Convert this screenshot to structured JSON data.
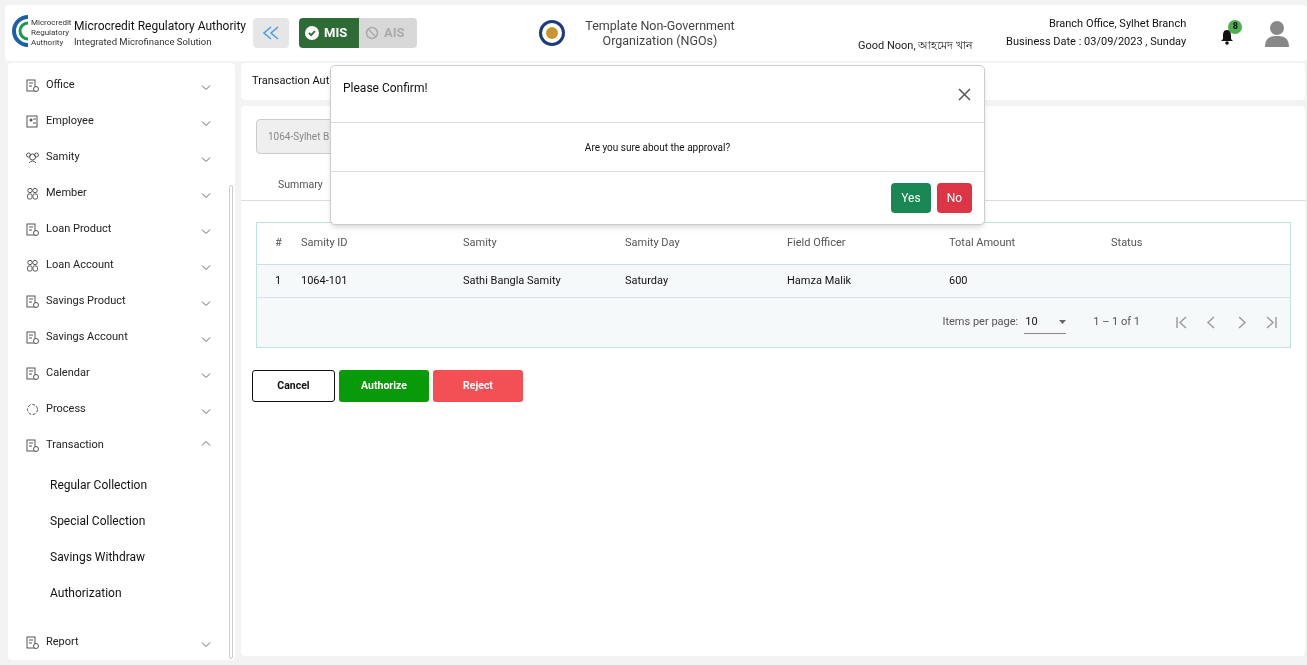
{
  "header": {
    "logo_text": [
      "Microcredit",
      "Regulatory",
      "Authority"
    ],
    "title": "Microcredit Regulatory Authority",
    "subtitle": "Integrated Microfinance Solution",
    "modes": [
      {
        "label": "MIS",
        "selected": true
      },
      {
        "label": "AIS",
        "selected": false
      }
    ],
    "organization": "Template Non-Government Organization (NGOs)",
    "greeting": "Good Noon, আহমেদ খান",
    "branch": "Branch Office, Sylhet Branch",
    "business_date": "Business Date : 03/09/2023 , Sunday",
    "notification_count": "8"
  },
  "sidebar": {
    "items": [
      {
        "label": "Office",
        "kind": "doc",
        "expanded": false
      },
      {
        "label": "Employee",
        "kind": "badge",
        "expanded": false
      },
      {
        "label": "Samity",
        "kind": "group",
        "expanded": false
      },
      {
        "label": "Member",
        "kind": "people",
        "expanded": false
      },
      {
        "label": "Loan Product",
        "kind": "doc",
        "expanded": false
      },
      {
        "label": "Loan Account",
        "kind": "people",
        "expanded": false
      },
      {
        "label": "Savings Product",
        "kind": "doc",
        "expanded": false
      },
      {
        "label": "Savings Account",
        "kind": "doc",
        "expanded": false
      },
      {
        "label": "Calendar",
        "kind": "doc",
        "expanded": false
      },
      {
        "label": "Process",
        "kind": "process",
        "expanded": false
      },
      {
        "label": "Transaction",
        "kind": "doc",
        "expanded": true,
        "children": [
          {
            "label": "Regular Collection"
          },
          {
            "label": "Special Collection"
          },
          {
            "label": "Savings Withdraw"
          },
          {
            "label": "Authorization"
          }
        ]
      },
      {
        "label": "Report",
        "kind": "doc",
        "expanded": false
      }
    ]
  },
  "breadcrumb": "Transaction Aut",
  "branch_select": {
    "value": "1064-Sylhet B"
  },
  "tabs": [
    {
      "label": "Summary"
    }
  ],
  "table": {
    "columns": [
      "#",
      "Samity ID",
      "Samity",
      "Samity Day",
      "Field Officer",
      "Total Amount",
      "Status"
    ],
    "rows": [
      [
        "1",
        "1064-101",
        "Sathi Bangla Samity",
        "Saturday",
        "Hamza Malik",
        "600",
        ""
      ]
    ]
  },
  "paginator": {
    "label": "Items per page:",
    "page_size": "10",
    "range": "1 – 1 of 1"
  },
  "actions": [
    {
      "label": "Cancel",
      "kind": "outline"
    },
    {
      "label": "Authorize",
      "kind": "primary"
    },
    {
      "label": "Reject",
      "kind": "danger"
    }
  ],
  "dialog": {
    "title": "Please Confirm!",
    "message": "Are you sure about the approval?",
    "buttons": [
      {
        "label": "Yes",
        "kind": "confirm"
      },
      {
        "label": "No",
        "kind": "cancel"
      }
    ]
  }
}
